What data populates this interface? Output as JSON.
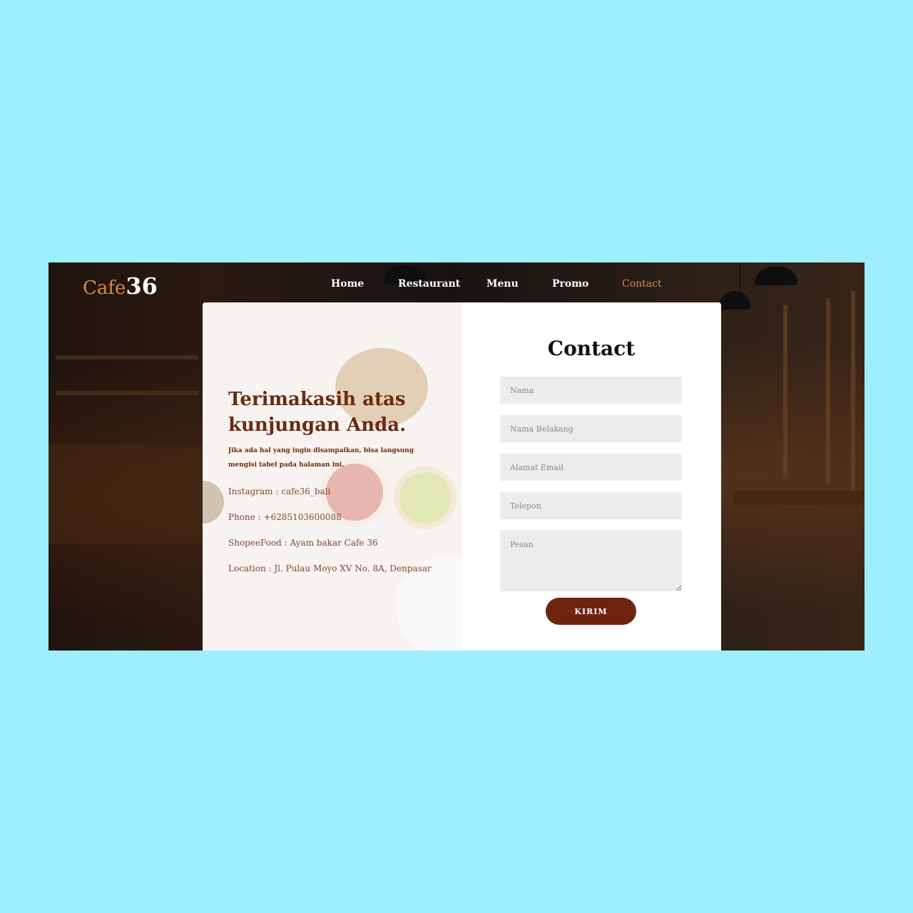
{
  "brand": {
    "prefix": "Cafe",
    "number": "36"
  },
  "nav": {
    "items": [
      {
        "label": "Home"
      },
      {
        "label": "Restaurant"
      },
      {
        "label": "Menu"
      },
      {
        "label": "Promo"
      },
      {
        "label": "Contact"
      }
    ],
    "active": "Contact"
  },
  "info": {
    "headline": "Terimakasih atas kunjungan Anda.",
    "intro": "Jika ada hal yang ingin disampaikan, bisa langsung mengisi tabel pada halaman ini.",
    "instagram": "Instagram : cafe36_bali",
    "phone": "Phone : +6285103600088",
    "shopeefood": "ShopeeFood : Ayam bakar Cafe 36",
    "location": "Location : Jl. Pulau Moyo XV No. 8A, Denpasar"
  },
  "form": {
    "title": "Contact",
    "first_name_placeholder": "Nama",
    "last_name_placeholder": "Nama Belakang",
    "email_placeholder": "Alamat Email",
    "phone_placeholder": "Telepon",
    "message_placeholder": "Pesan",
    "submit_label": "KIRIM"
  },
  "colors": {
    "page_background": "#9deeff",
    "accent_brown": "#6e2410",
    "nav_active": "#d08a4e",
    "field_background": "#ececec"
  }
}
